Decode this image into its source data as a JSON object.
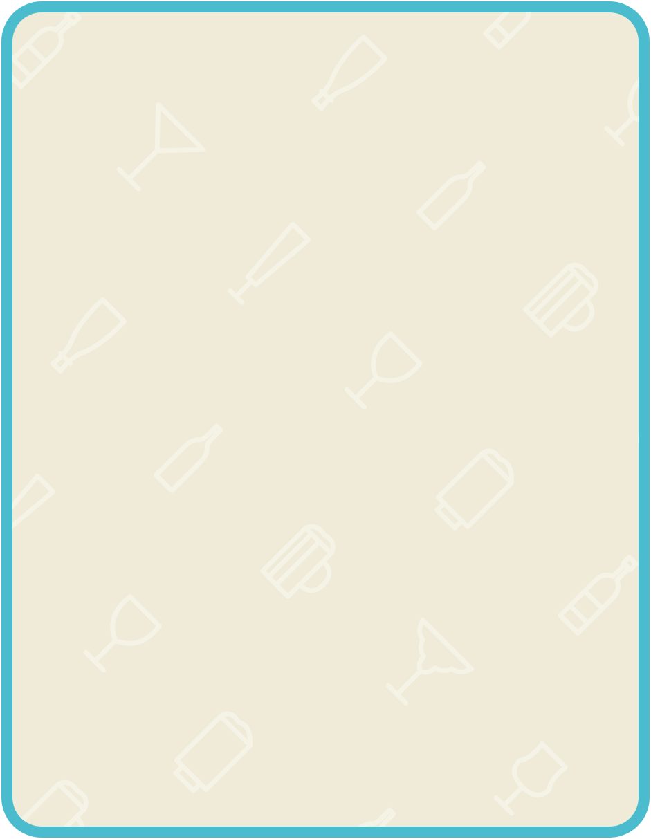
{
  "background": {
    "card_color": "#efebd8",
    "border_color": "#4bbccd",
    "pattern_color": "#f5f2e6"
  },
  "pattern_icons": [
    "beer-bottle-icon",
    "pilsner-glass-icon",
    "martini-glass-icon",
    "wine-bottle-icon",
    "champagne-flute-icon",
    "mug-icon",
    "wine-glass-icon",
    "beer-mug-icon",
    "margarita-glass-icon"
  ]
}
